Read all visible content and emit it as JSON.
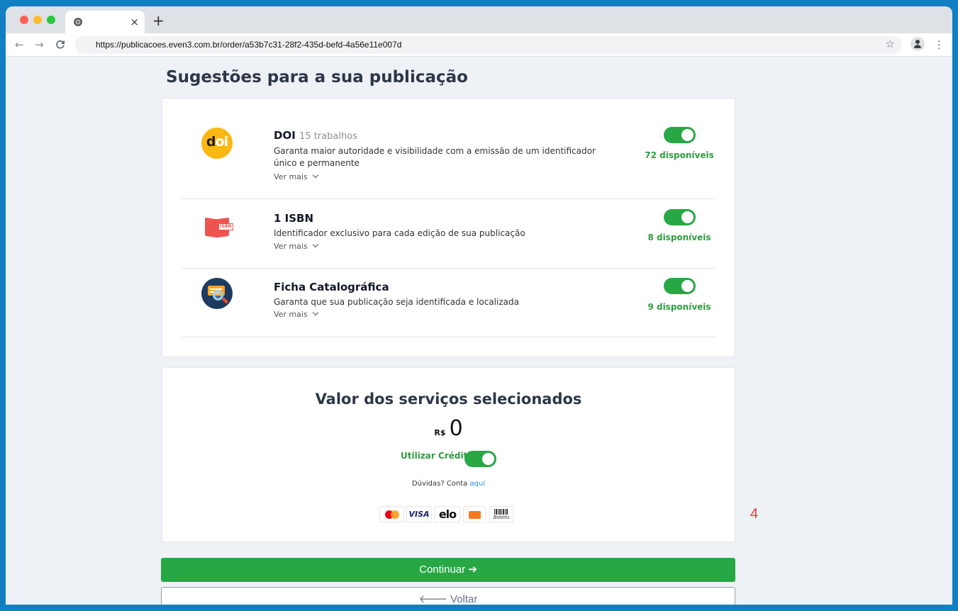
{
  "browser": {
    "tab_close": "×",
    "new_tab": "+",
    "back": "←",
    "forward": "→",
    "reload": "C",
    "url": "https://publicacoes.even3.com.br/order/a53b7c31-28f2-435d-befd-4a56e11e007d",
    "bookmark": "☆",
    "menu": "⋮"
  },
  "page": {
    "title": "Sugestões para a sua publicação"
  },
  "services": [
    {
      "icon": "doi-icon",
      "name": "DOI",
      "count": "15 trabalhos",
      "description": "Garanta maior autoridade e visibilidade com a emissão de um identificador único e permanente",
      "more": "Ver mais",
      "enabled": true,
      "available": "72 disponíveis"
    },
    {
      "icon": "isbn-icon",
      "name": "1 ISBN",
      "count": "",
      "description": "Identificador exclusivo para cada edição de sua publicação",
      "more": "Ver mais",
      "enabled": true,
      "available": "8 disponíveis",
      "icon_text": "ISBN"
    },
    {
      "icon": "catalog-card-icon",
      "name": "Ficha Catalográfica",
      "count": "",
      "description": "Garanta que sua publicação seja identificada e localizada",
      "more": "Ver mais",
      "enabled": true,
      "available": "9 disponíveis"
    }
  ],
  "total": {
    "title": "Valor dos serviços selecionados",
    "currency": "R$",
    "amount": "0",
    "credit_label": "Utilizar Crédito",
    "credit_enabled": true,
    "help_text": "Dúvidas? Conta",
    "help_link": "aqui",
    "payments": [
      "mastercard",
      "visa",
      "elo",
      "hipercard",
      "boleto"
    ],
    "visa_text": "VISA",
    "elo_text": "elo",
    "boleto_text": "Boleto"
  },
  "actions": {
    "continue_label": "Continuar ➔",
    "back_label": "🡐 Voltar"
  },
  "annotation": {
    "step": "4"
  },
  "colors": {
    "accent_green": "#28a745",
    "available_green": "#2e9e3f",
    "doi_yellow": "#fbb812",
    "step_red": "#e53935",
    "background_blue": "#127fc2"
  }
}
